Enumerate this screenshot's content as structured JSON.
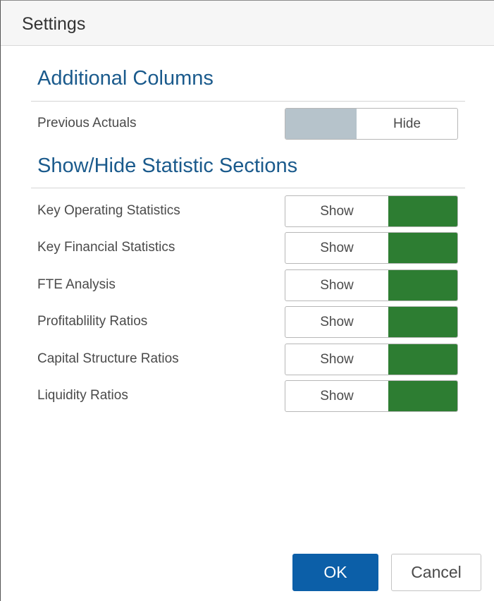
{
  "dialog": {
    "title": "Settings"
  },
  "additional_columns": {
    "heading": "Additional Columns",
    "rows": [
      {
        "label": "Previous Actuals",
        "toggle_text": "Hide",
        "state": "off"
      }
    ]
  },
  "statistic_sections": {
    "heading": "Show/Hide Statistic Sections",
    "rows": [
      {
        "label": "Key Operating Statistics",
        "toggle_text": "Show",
        "state": "on"
      },
      {
        "label": "Key Financial Statistics",
        "toggle_text": "Show",
        "state": "on"
      },
      {
        "label": "FTE Analysis",
        "toggle_text": "Show",
        "state": "on"
      },
      {
        "label": "Profitablility Ratios",
        "toggle_text": "Show",
        "state": "on"
      },
      {
        "label": "Capital Structure Ratios",
        "toggle_text": "Show",
        "state": "on"
      },
      {
        "label": "Liquidity Ratios",
        "toggle_text": "Show",
        "state": "on"
      }
    ]
  },
  "footer": {
    "ok_label": "OK",
    "cancel_label": "Cancel"
  },
  "colors": {
    "heading": "#1a5a8c",
    "toggle_on": "#2d7d32",
    "toggle_off": "#b6c3cb",
    "primary_button": "#0c5fa8"
  }
}
